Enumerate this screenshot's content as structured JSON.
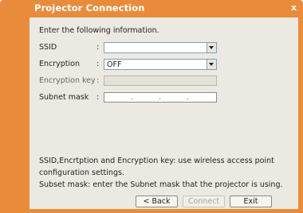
{
  "window": {
    "title": "Projector Connection",
    "close_glyph": "x"
  },
  "intro": "Enter the following information.",
  "fields": {
    "ssid": {
      "label": "SSID",
      "colon": ":",
      "value": ""
    },
    "encryption": {
      "label": "Encryption",
      "colon": ":",
      "value": "OFF"
    },
    "encryption_key": {
      "label": "Encryption key",
      "colon": ":",
      "value": ""
    },
    "subnet_mask": {
      "label": "Subnet mask",
      "colon": ":",
      "dots": [
        ".",
        ".",
        "."
      ]
    }
  },
  "help": {
    "line1": "SSID,Encrtption and Encryption key: use wireless access point",
    "line2": "configuration settings.",
    "line3": "Subset mask: enter the Subnet mask that the projector is using."
  },
  "buttons": {
    "back": "< Back",
    "connect": "Connect",
    "exit": "Exit"
  }
}
